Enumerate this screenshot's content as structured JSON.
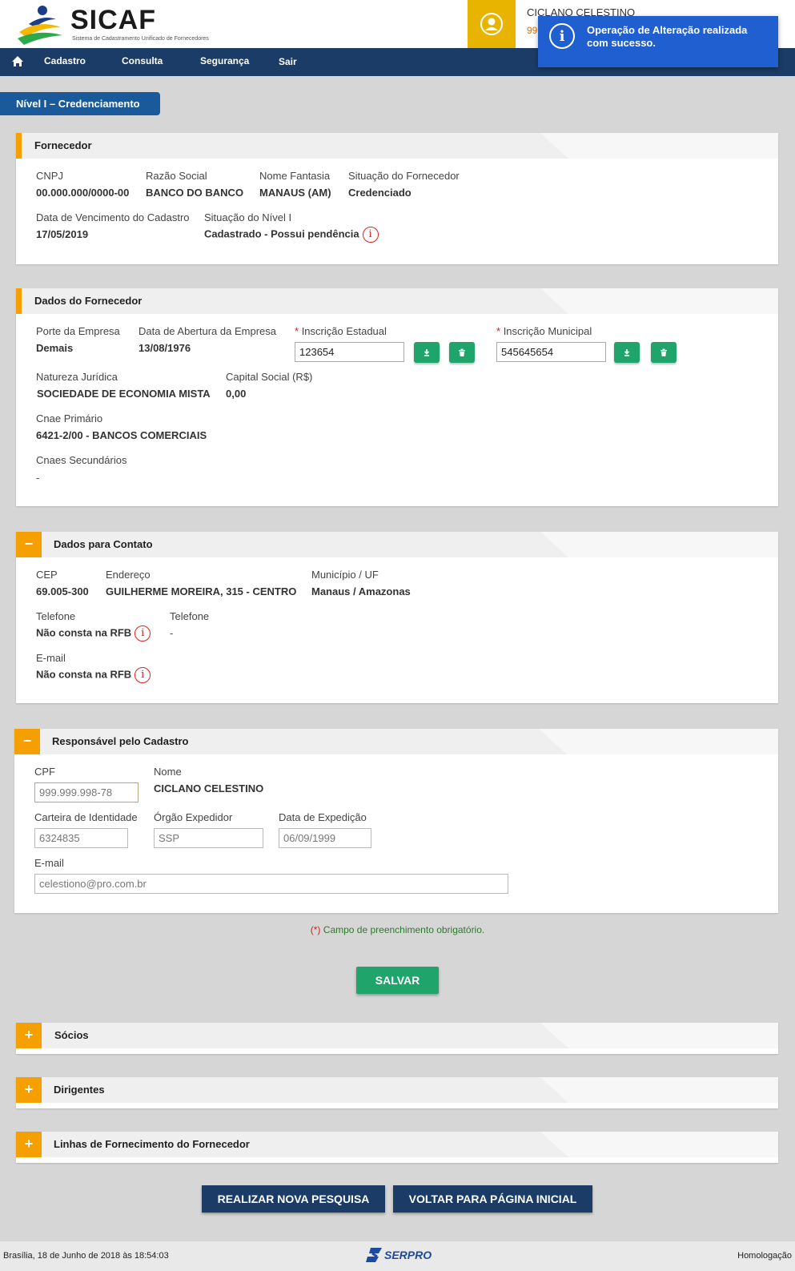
{
  "header": {
    "logo_text": "SICAF",
    "logo_subtitle": "Sistema de Cadastramento Unificado de Fornecedores",
    "user_name": "CICLANO CELESTINO",
    "user_cpf": "999"
  },
  "nav": {
    "items": [
      "Cadastro",
      "Consulta",
      "Segurança",
      "Sair"
    ]
  },
  "toast": {
    "message": "Operação de Alteração realizada com sucesso."
  },
  "level_tab": "Nível I – Credenciamento",
  "fornecedor": {
    "title": "Fornecedor",
    "cnpj_label": "CNPJ",
    "cnpj": "00.000.000/0000-00",
    "razao_label": "Razão Social",
    "razao": "BANCO DO BANCO",
    "fantasia_label": "Nome Fantasia",
    "fantasia": "MANAUS (AM)",
    "situacao_label": "Situação do Fornecedor",
    "situacao": "Credenciado",
    "vencimento_label": "Data de Vencimento do Cadastro",
    "vencimento": "17/05/2019",
    "nivel_label": "Situação do Nível I",
    "nivel": "Cadastrado - Possui pendência"
  },
  "dados": {
    "title": "Dados do Fornecedor",
    "porte_label": "Porte da Empresa",
    "porte": "Demais",
    "abertura_label": "Data de Abertura da Empresa",
    "abertura": "13/08/1976",
    "ie_label": "Inscrição Estadual",
    "ie": "123654",
    "im_label": "Inscrição Municipal",
    "im": "545645654",
    "natureza_label": "Natureza Jurídica",
    "natureza": "SOCIEDADE DE ECONOMIA MISTA",
    "capital_label": "Capital Social (R$)",
    "capital": "0,00",
    "cnae_label": "Cnae Primário",
    "cnae": "6421-2/00 - BANCOS COMERCIAIS",
    "cnaes_sec_label": "Cnaes Secundários",
    "cnaes_sec": "-"
  },
  "contato": {
    "title": "Dados para Contato",
    "toggle": "−",
    "cep_label": "CEP",
    "cep": "69.005-300",
    "endereco_label": "Endereço",
    "endereco": "GUILHERME MOREIRA, 315 - CENTRO",
    "municipio_label": "Município / UF",
    "municipio": "Manaus / Amazonas",
    "tel1_label": "Telefone",
    "tel1": "Não consta na RFB",
    "tel2_label": "Telefone",
    "tel2": "-",
    "email_label": "E-mail",
    "email": "Não consta na RFB"
  },
  "responsavel": {
    "title": "Responsável pelo Cadastro",
    "toggle": "−",
    "cpf_label": "CPF",
    "cpf": "999.999.998-78",
    "nome_label": "Nome",
    "nome": "CICLANO CELESTINO",
    "rg_label": "Carteira de Identidade",
    "rg": "6324835",
    "orgao_label": "Órgão Expedidor",
    "orgao": "SSP",
    "expedicao_label": "Data de Expedição",
    "expedicao": "06/09/1999",
    "email_label": "E-mail",
    "email": "celestiono@pro.com.br"
  },
  "mandatory_note": "Campo de preenchimento obrigatório.",
  "mandatory_mark": "(*)",
  "required_mark": "*",
  "info_symbol": "i",
  "save_label": "SALVAR",
  "socios": {
    "title": "Sócios",
    "toggle": "+"
  },
  "dirigentes": {
    "title": "Dirigentes",
    "toggle": "+"
  },
  "linhas": {
    "title": "Linhas de Fornecimento do Fornecedor",
    "toggle": "+"
  },
  "buttons": {
    "nova_pesquisa": "REALIZAR NOVA PESQUISA",
    "voltar": "VOLTAR PARA PÁGINA INICIAL"
  },
  "footer": {
    "datetime": "Brasília, 18 de Junho de 2018 às 18:54:03",
    "brand": "SERPRO",
    "env": "Homologação"
  },
  "colors": {
    "nav": "#1b3c66",
    "accent": "#f5a000",
    "success": "#1fa56b",
    "toast": "#1f5fcf",
    "alert": "#dd2222"
  }
}
